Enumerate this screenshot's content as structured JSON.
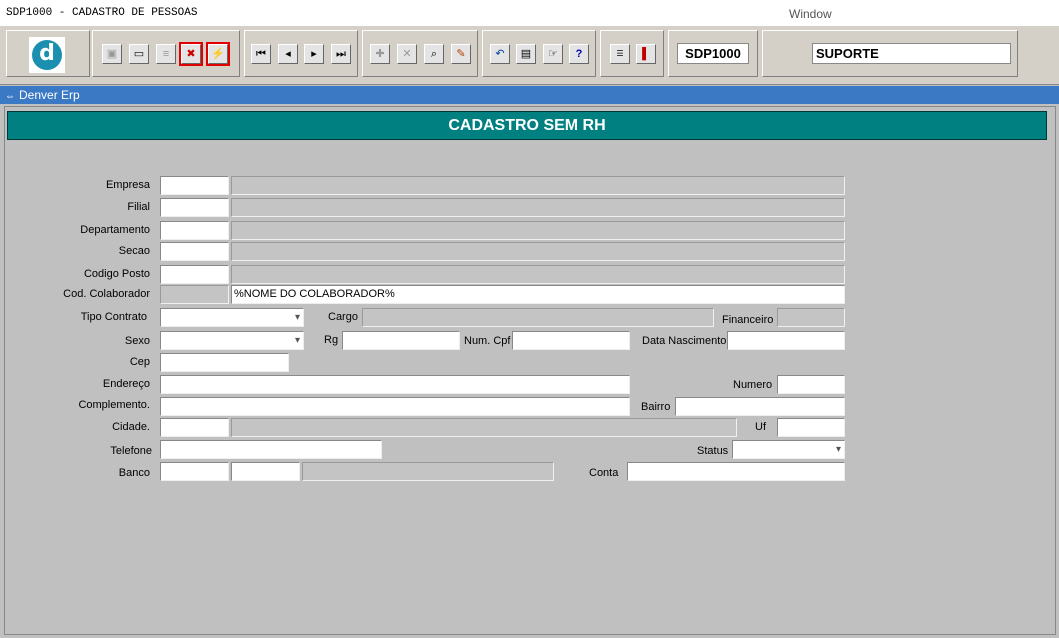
{
  "window": {
    "title": "SDP1000 - CADASTRO DE PESSOAS",
    "menu": "Window"
  },
  "toolbar": {
    "code": "SDP1000",
    "user": "SUPORTE",
    "logo_letter": "d",
    "icons": [
      "save-icon",
      "window-icon",
      "print-icon",
      "delete-record-icon",
      "execute-icon",
      "first-record-icon",
      "prev-record-icon",
      "next-record-icon",
      "last-record-icon",
      "add-record-icon",
      "remove-record-icon",
      "search-icon",
      "edit-icon",
      "undo-icon",
      "clipboard-icon",
      "tools-icon",
      "help-icon",
      "menu-icon",
      "exit-icon"
    ]
  },
  "app": {
    "name": "Denver Erp"
  },
  "form": {
    "title": "CADASTRO SEM RH",
    "labels": {
      "empresa": "Empresa",
      "filial": "Filial",
      "departamento": "Departamento",
      "secao": "Secao",
      "codigo_posto": "Codigo Posto",
      "cod_colaborador": "Cod. Colaborador",
      "tipo_contrato": "Tipo Contrato",
      "cargo": "Cargo",
      "financeiro": "Financeiro",
      "sexo": "Sexo",
      "rg": "Rg",
      "num_cpf": "Num. Cpf",
      "data_nascimento": "Data Nascimento",
      "cep": "Cep",
      "endereco": "Endereço",
      "numero": "Numero",
      "complemento": "Complemento.",
      "bairro": "Bairro",
      "cidade": "Cidade.",
      "uf": "Uf",
      "telefone": "Telefone",
      "status": "Status",
      "banco": "Banco",
      "conta": "Conta"
    },
    "values": {
      "nome_colaborador": "%NOME DO COLABORADOR%"
    }
  }
}
